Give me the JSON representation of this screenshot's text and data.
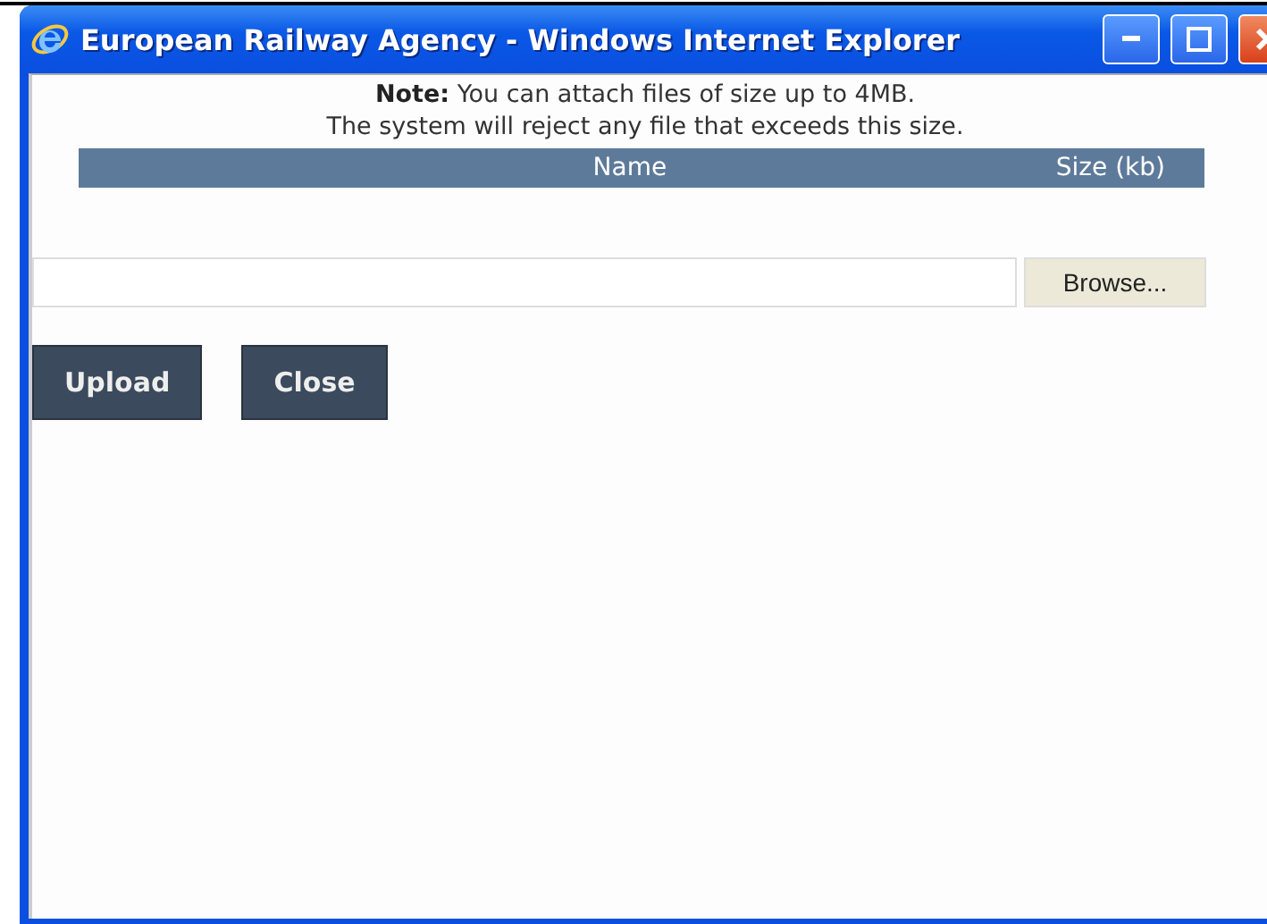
{
  "window": {
    "title": "European Railway Agency - Windows Internet Explorer"
  },
  "note": [
    "**Note:** You can attach files of size up to 4MB.",
    "The system will reject any file that exceeds this size."
  ],
  "table": {
    "columns": [
      "Name",
      "Size (kb)"
    ]
  },
  "file_picker": {
    "browse_label": "Browse..."
  },
  "buttons": [
    "Upload",
    "Close"
  ]
}
